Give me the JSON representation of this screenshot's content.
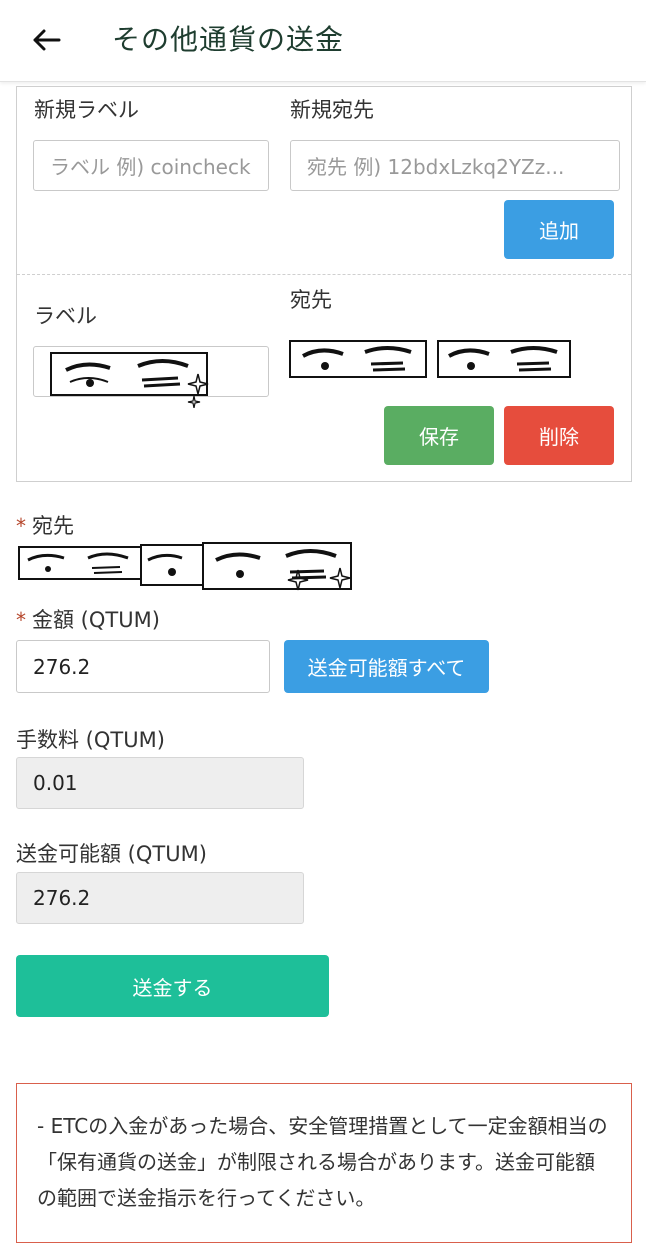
{
  "header": {
    "title": "その他通貨の送金"
  },
  "address_book": {
    "new_label_title": "新規ラベル",
    "new_label_placeholder": "ラベル 例) coincheck",
    "new_address_title": "新規宛先",
    "new_address_placeholder": "宛先 例) 12bdxLzkq2YZz...",
    "add_label": "追加",
    "entry_label_title": "ラベル",
    "entry_address_title": "宛先",
    "save_label": "保存",
    "delete_label": "削除"
  },
  "form": {
    "address_title": "宛先",
    "amount_title": "金額 (QTUM)",
    "amount_value": "276.2",
    "send_all_label": "送金可能額すべて",
    "fee_title": "手数料 (QTUM)",
    "fee_value": "0.01",
    "available_title": "送金可能額 (QTUM)",
    "available_value": "276.2",
    "submit_label": "送金する",
    "required_mark": "*"
  },
  "notice": {
    "text": "- ETCの入金があった場合、安全管理措置として一定金額相当の「保有通貨の送金」が制限される場合があります。送金可能額の範囲で送金指示を行ってください。"
  },
  "colors": {
    "primary_blue": "#3b9ee3",
    "save_green": "#5aad62",
    "delete_red": "#e64d3d",
    "submit_teal": "#1ebf99"
  }
}
